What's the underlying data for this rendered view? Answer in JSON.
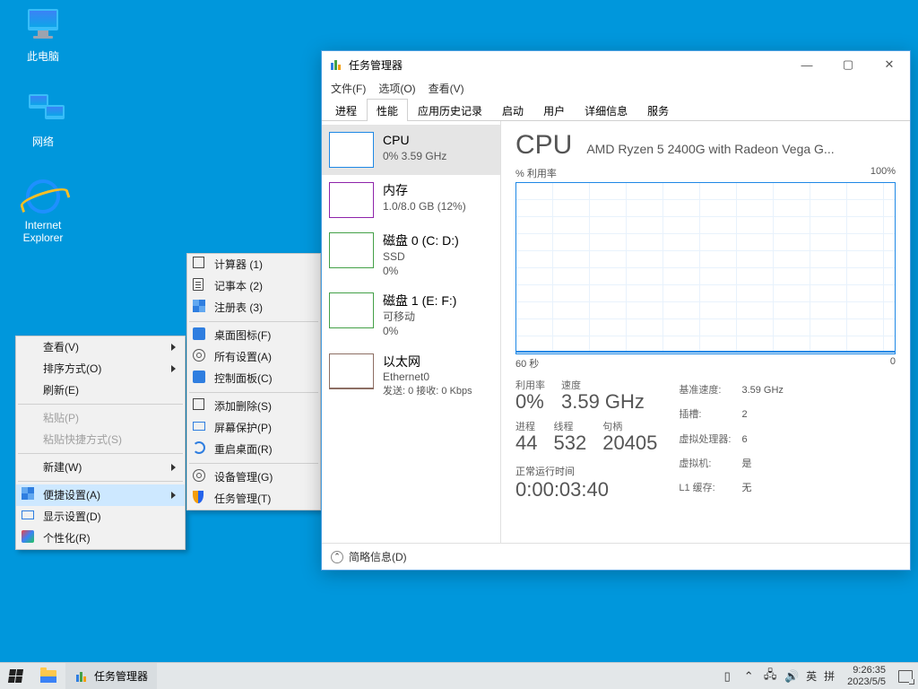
{
  "desktop": {
    "icons": [
      "此电脑",
      "网络",
      "Internet Explorer"
    ]
  },
  "ctx1": {
    "view": "查看(V)",
    "sort": "排序方式(O)",
    "refresh": "刷新(E)",
    "paste": "粘贴(P)",
    "paste_sc": "粘贴快捷方式(S)",
    "new": "新建(W)",
    "quick": "便捷设置(A)",
    "display": "显示设置(D)",
    "personalize": "个性化(R)"
  },
  "ctx2": {
    "calc": "计算器  (1)",
    "notepad": "记事本  (2)",
    "regedit": "注册表  (3)",
    "deskicon": "桌面图标(F)",
    "allsettings": "所有设置(A)",
    "control": "控制面板(C)",
    "add_remove": "添加删除(S)",
    "screensaver": "屏幕保护(P)",
    "restart_desk": "重启桌面(R)",
    "devmgr": "设备管理(G)",
    "taskmgr": "任务管理(T)"
  },
  "tm": {
    "title": "任务管理器",
    "menus": [
      "文件(F)",
      "选项(O)",
      "查看(V)"
    ],
    "tabs": [
      "进程",
      "性能",
      "应用历史记录",
      "启动",
      "用户",
      "详细信息",
      "服务"
    ],
    "side": {
      "cpu": {
        "t": "CPU",
        "d": "0% 3.59 GHz"
      },
      "mem": {
        "t": "内存",
        "d": "1.0/8.0 GB (12%)"
      },
      "d0": {
        "t": "磁盘 0 (C: D:)",
        "d1": "SSD",
        "d2": "0%"
      },
      "d1": {
        "t": "磁盘 1 (E: F:)",
        "d1": "可移动",
        "d2": "0%"
      },
      "eth": {
        "t": "以太网",
        "d1": "Ethernet0",
        "d2": "发送: 0 接收: 0 Kbps"
      }
    },
    "main": {
      "big": "CPU",
      "name": "AMD Ryzen 5 2400G with Radeon Vega G...",
      "ylabel": "% 利用率",
      "ymax": "100%",
      "x0": "60 秒",
      "x1": "0",
      "util_l": "利用率",
      "util_v": "0%",
      "speed_l": "速度",
      "speed_v": "3.59 GHz",
      "proc_l": "进程",
      "proc_v": "44",
      "thr_l": "线程",
      "thr_v": "532",
      "hnd_l": "句柄",
      "hnd_v": "20405",
      "base_l": "基准速度:",
      "base_v": "3.59 GHz",
      "sock_l": "插槽:",
      "sock_v": "2",
      "vcpu_l": "虚拟处理器:",
      "vcpu_v": "6",
      "vm_l": "虚拟机:",
      "vm_v": "是",
      "l1_l": "L1 缓存:",
      "l1_v": "无",
      "up_l": "正常运行时间",
      "up_v": "0:00:03:40"
    },
    "footer": "简略信息(D)"
  },
  "taskbar": {
    "app": "任务管理器",
    "ime1": "英",
    "ime2": "拼",
    "time": "9:26:35",
    "date": "2023/5/5"
  },
  "chart_data": {
    "type": "line",
    "title": "CPU % 利用率",
    "xlabel": "秒",
    "ylabel": "% 利用率",
    "x_range": [
      60,
      0
    ],
    "ylim": [
      0,
      100
    ],
    "series": [
      {
        "name": "CPU",
        "values": [
          0,
          0,
          0,
          0,
          0,
          0,
          0,
          0,
          0,
          0,
          0,
          0,
          0,
          0,
          0,
          0,
          0,
          0,
          0,
          0,
          0,
          0,
          0,
          0,
          0,
          0,
          0,
          0,
          0,
          0,
          0,
          0,
          0,
          0,
          0,
          0,
          0,
          0,
          0,
          0,
          0,
          0,
          0,
          0,
          0,
          0,
          0,
          0,
          0,
          0,
          0,
          0,
          0,
          0,
          0,
          0,
          0,
          0,
          0,
          0
        ]
      }
    ]
  }
}
